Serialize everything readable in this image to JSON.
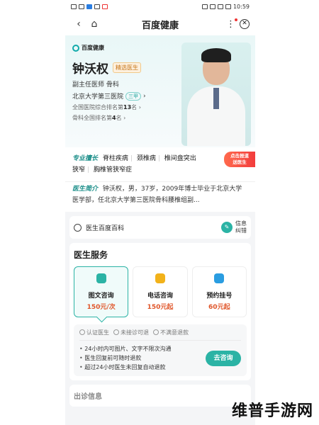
{
  "status_bar": {
    "time": "10:59"
  },
  "nav": {
    "title": "百度健康",
    "back_icon": "back-arrow-icon",
    "home_icon": "home-icon",
    "more_icon": "more-dots-icon",
    "close_icon": "close-circle-icon"
  },
  "header": {
    "logo_text": "百度健康",
    "doctor_name": "钟沃权",
    "badge": "精选医生",
    "title_line": "副主任医师 骨科",
    "hospital": "北京大学第三医院",
    "hospital_level": "三甲",
    "rank_national_prefix": "全国医院综合排名第",
    "rank_national_num": "13",
    "rank_national_suffix": "名",
    "rank_ortho_prefix": "骨科全国排名第",
    "rank_ortho_num": "4",
    "rank_ortho_suffix": "名"
  },
  "specialty": {
    "label": "专业擅长",
    "tags": [
      "脊柱疾病",
      "颈椎病",
      "椎间盘突出",
      "狭窄",
      "胸椎管狭窄症"
    ],
    "online_tag_line1": "点击报道",
    "online_tag_line2": "送医生"
  },
  "intro": {
    "label": "医生简介",
    "text": "钟沃权，男，37岁，2009年博士毕业于北京大学医学部，任北京大学第三医院骨科腰椎组副..."
  },
  "baike": {
    "label": "医生百度百科",
    "info_fix_line1": "信息",
    "info_fix_line2": "纠错"
  },
  "service": {
    "title": "医生服务",
    "cards": [
      {
        "name": "图文咨询",
        "price": "150元/次",
        "icon_color": "#2bb3a5"
      },
      {
        "name": "电话咨询",
        "price": "150元起",
        "icon_color": "#f2b21a"
      },
      {
        "name": "预约挂号",
        "price": "60元起",
        "icon_color": "#2a9de1"
      }
    ],
    "guarantees": [
      "认证医生",
      "未接诊可退",
      "不满意退款"
    ],
    "bullets": [
      "24小时内可图片、文字不限次沟通",
      "医生回复前可随时退款",
      "超过24小时医生未回复自动退款"
    ],
    "consult_button": "去咨询"
  },
  "schedule": {
    "title": "出诊信息"
  },
  "watermark": "维普手游网"
}
